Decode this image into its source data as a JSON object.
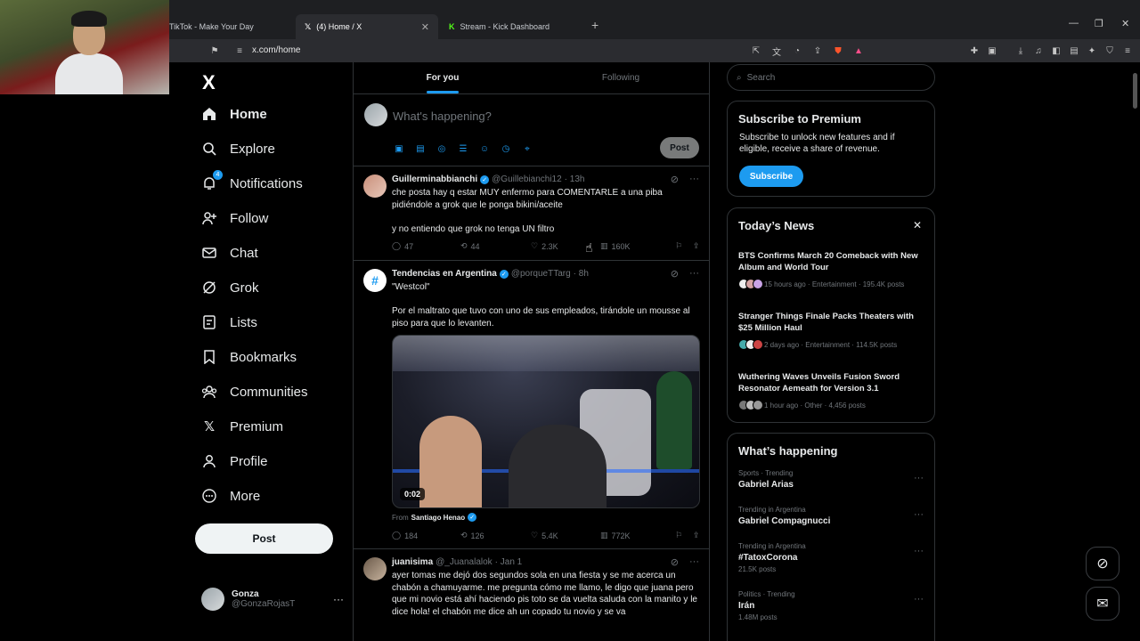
{
  "browser": {
    "tabs": [
      {
        "label": "TikTok - Make Your Day"
      },
      {
        "label": "(4) Home / X"
      },
      {
        "label": "Stream - Kick Dashboard"
      }
    ],
    "url": "x.com/home"
  },
  "sidebar": {
    "logo": "X",
    "items": [
      {
        "label": "Home",
        "icon": "home-icon"
      },
      {
        "label": "Explore",
        "icon": "search-icon"
      },
      {
        "label": "Notifications",
        "icon": "bell-icon",
        "badge": "4"
      },
      {
        "label": "Follow",
        "icon": "person-add-icon"
      },
      {
        "label": "Chat",
        "icon": "mail-icon"
      },
      {
        "label": "Grok",
        "icon": "grok-icon"
      },
      {
        "label": "Lists",
        "icon": "list-icon"
      },
      {
        "label": "Bookmarks",
        "icon": "bookmark-icon"
      },
      {
        "label": "Communities",
        "icon": "communities-icon"
      },
      {
        "label": "Premium",
        "icon": "x-premium-icon"
      },
      {
        "label": "Profile",
        "icon": "person-icon"
      },
      {
        "label": "More",
        "icon": "more-circle-icon"
      }
    ],
    "post_label": "Post",
    "account": {
      "name": "Gonza",
      "handle": "@GonzaRojasT"
    }
  },
  "timeline": {
    "tabs": [
      "For you",
      "Following"
    ],
    "compose": {
      "placeholder": "What's happening?",
      "post_label": "Post"
    },
    "tweets": [
      {
        "name": "Guillerminabbianchi",
        "handle": "@Guillebianchi12",
        "time": "· 13h",
        "text": "che posta hay q estar MUY enfermo para COMENTARLE a una piba pidiéndole a grok que le ponga bikini/aceite\n\ny no entiendo que grok no tenga UN filtro",
        "replies": "47",
        "reposts": "44",
        "likes": "2.3K",
        "views": "160K"
      },
      {
        "name": "Tendencias en Argentina",
        "handle": "@porqueTTarg",
        "time": "· 8h",
        "text": "\"Westcol\"\n\nPor el maltrato que tuvo con uno de sus empleados, tirándole un mousse al piso para que lo levanten.",
        "video_duration": "0:02",
        "from_label": "From",
        "from_name": "Santiago Henao",
        "replies": "184",
        "reposts": "126",
        "likes": "5.4K",
        "views": "772K"
      },
      {
        "name": "juanisima",
        "handle": "@_Juanalalok",
        "time": "· Jan 1",
        "text": "ayer tomas me dejó dos segundos sola en una fiesta y se me acerca un chabón a chamuyarme. me pregunta cómo me llamo, le digo que juana pero que mi novio está ahí haciendo pis toto se da vuelta saluda con la manito y le dice hola! el chabón me dice ah un copado tu novio y se va"
      }
    ]
  },
  "right": {
    "search_placeholder": "Search",
    "premium": {
      "title": "Subscribe to Premium",
      "desc": "Subscribe to unlock new features and if eligible, receive a share of revenue.",
      "button": "Subscribe"
    },
    "news": {
      "title": "Today’s News",
      "items": [
        {
          "title": "BTS Confirms March 20 Comeback with New Album and World Tour",
          "meta": "15 hours ago · Entertainment · 195.4K posts"
        },
        {
          "title": "Stranger Things Finale Packs Theaters with $25 Million Haul",
          "meta": "2 days ago · Entertainment · 114.5K posts"
        },
        {
          "title": "Wuthering Waves Unveils Fusion Sword Resonator Aemeath for Version 3.1",
          "meta": "1 hour ago · Other · 4,456 posts"
        }
      ]
    },
    "happening": {
      "title": "What’s happening",
      "items": [
        {
          "context": "Sports · Trending",
          "name": "Gabriel Arias",
          "count": ""
        },
        {
          "context": "Trending in Argentina",
          "name": "Gabriel Compagnucci",
          "count": ""
        },
        {
          "context": "Trending in Argentina",
          "name": "#TatoxCorona",
          "count": "21.5K posts"
        },
        {
          "context": "Politics · Trending",
          "name": "Irán",
          "count": "1.48M posts"
        }
      ]
    }
  },
  "colors": {
    "accent": "#1d9bf0",
    "background": "#000000",
    "border": "#2f3336",
    "muted": "#71767b"
  }
}
